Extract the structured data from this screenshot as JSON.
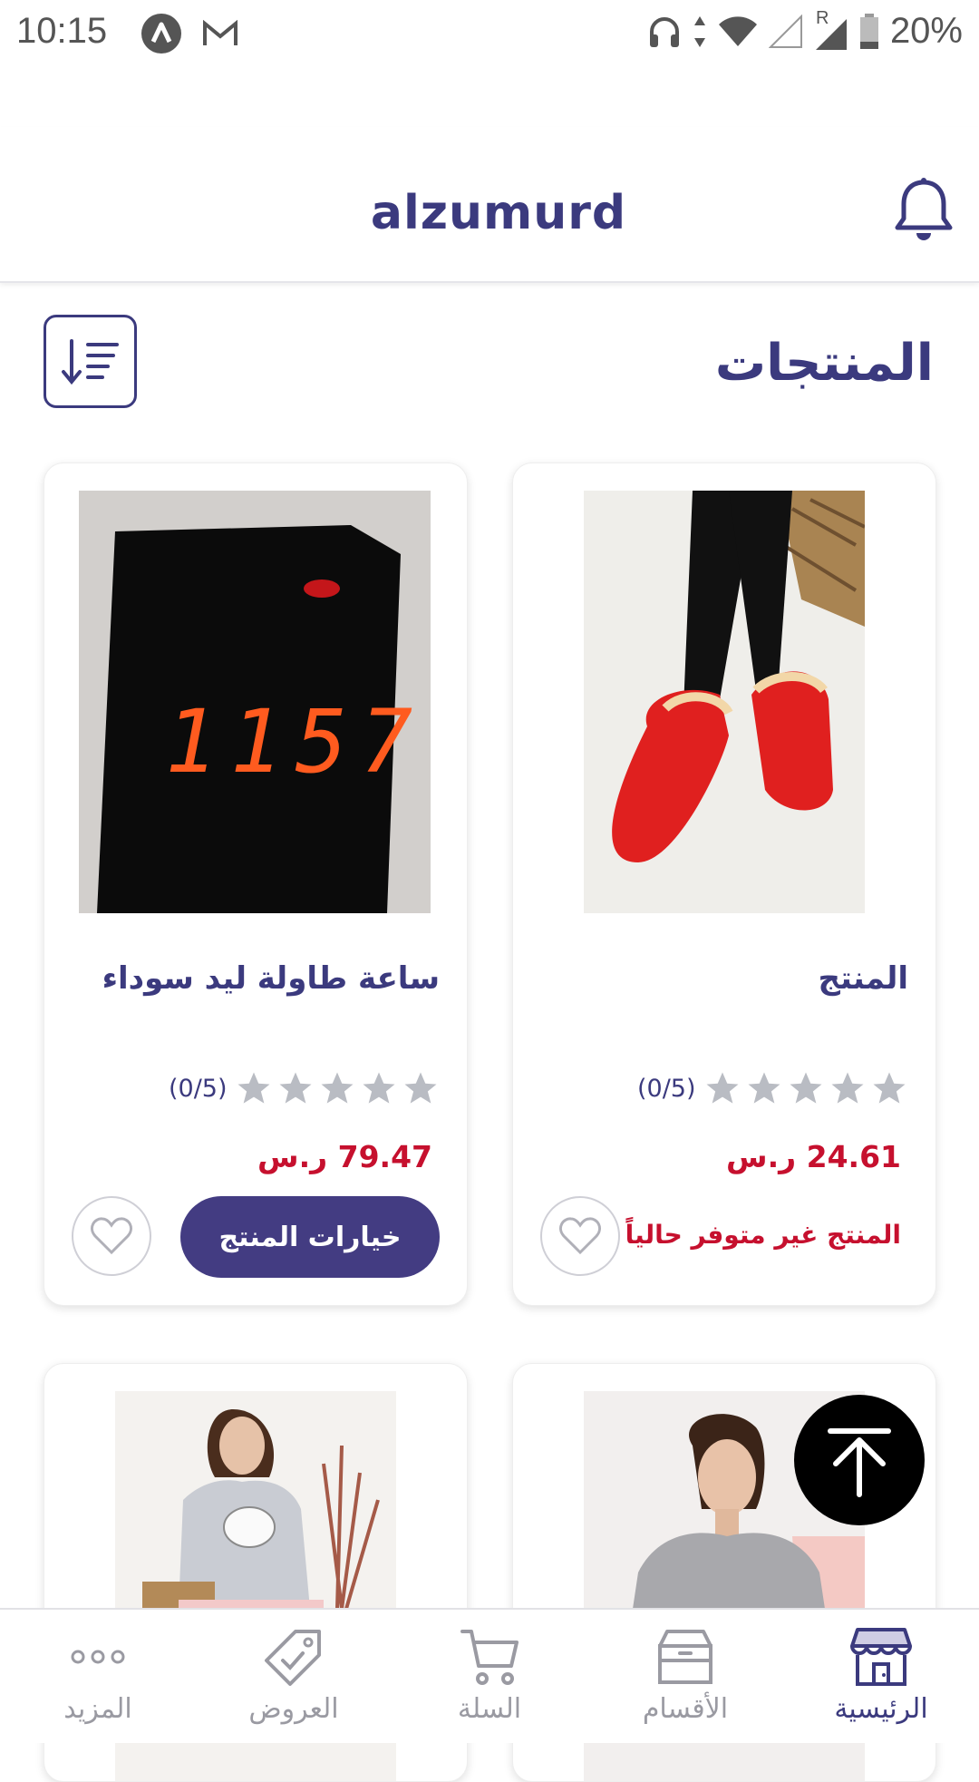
{
  "status_bar": {
    "time": "10:15",
    "battery": "20%",
    "icons": [
      "a-icon",
      "gmail-icon",
      "headphones-icon",
      "data-arrows-icon",
      "wifi-icon",
      "signal-icon",
      "roaming-signal-icon",
      "battery-icon"
    ],
    "roaming_marker": "R"
  },
  "header": {
    "title": "alzumurd",
    "bell_icon": "bell-icon"
  },
  "section": {
    "title": "المنتجات",
    "sort_icon": "sort-descending-icon"
  },
  "products": [
    {
      "name": "المنتج",
      "rating_text": "(0/5)",
      "rating": 0,
      "price": "24.61 ر.س",
      "status": "المنتج غير متوفر حالياً",
      "image": "red-slippers-photo"
    },
    {
      "name": "ساعة طاولة ليد سوداء",
      "rating_text": "(0/5)",
      "rating": 0,
      "price": "79.47 ر.س",
      "options_label": "خيارات المنتج",
      "image": "black-led-cube-clock-photo",
      "clock_digits": "1157"
    },
    {
      "image": "woman-grey-sweater-photo"
    },
    {
      "image": "girl-pajamas-photo"
    }
  ],
  "bottom_nav": {
    "items": [
      {
        "label": "الرئيسية",
        "icon": "store-icon",
        "active": true
      },
      {
        "label": "الأقسام",
        "icon": "box-icon",
        "active": false
      },
      {
        "label": "السلة",
        "icon": "cart-icon",
        "active": false
      },
      {
        "label": "العروض",
        "icon": "tag-icon",
        "active": false
      },
      {
        "label": "المزيد",
        "icon": "more-dots-icon",
        "active": false
      }
    ]
  },
  "colors": {
    "primary": "#3b3a7e",
    "button": "#433c82",
    "price": "#c6102e",
    "inactive": "#9a9aa2"
  }
}
